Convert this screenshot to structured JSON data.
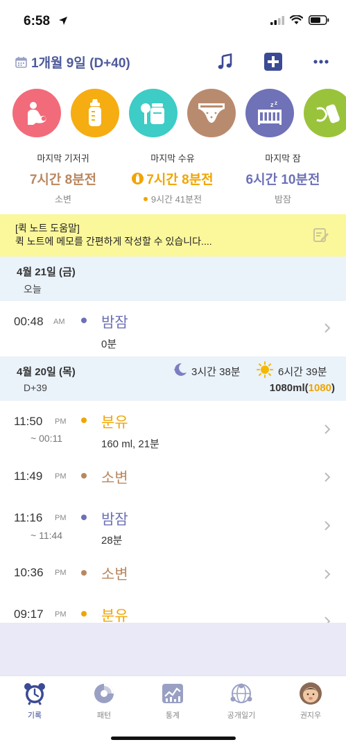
{
  "status": {
    "time": "6:58"
  },
  "header": {
    "date_title": "1개월 9일 (D+40)"
  },
  "categories": [
    {
      "name": "breastfeeding",
      "color": "#f26b7a"
    },
    {
      "name": "bottle",
      "color": "#f5ad12"
    },
    {
      "name": "pumped-milk",
      "color": "#3dccc6"
    },
    {
      "name": "diaper",
      "color": "#b98b6e"
    },
    {
      "name": "sleep",
      "color": "#6f72b7"
    },
    {
      "name": "baby-food",
      "color": "#9ac33c"
    }
  ],
  "summary": {
    "diaper": {
      "label": "마지막 기저귀",
      "value": "7시간 8분전",
      "sub": "소변",
      "color": "#b9875f"
    },
    "feeding": {
      "label": "마지막 수유",
      "value": "7시간 8분전",
      "sub": "9시간 41분전",
      "color": "#f0a500"
    },
    "sleep": {
      "label": "마지막 잠",
      "value": "6시간 10분전",
      "sub": "밤잠",
      "color": "#6c70b6"
    }
  },
  "quick_note": {
    "title": "[퀵 노트 도움말]",
    "body": "퀵 노트에 메모를 간편하게 작성할 수 있습니다...."
  },
  "days": [
    {
      "date": "4월 21일 (금)",
      "sub": "오늘"
    },
    {
      "date": "4월 20일 (목)",
      "sub": "D+39",
      "night_sleep": "3시간 38분",
      "day_sleep": "6시간 39분",
      "total_ml": "1080ml",
      "total_paren_open": "(",
      "total_paren_value": "1080",
      "total_paren_close": ")"
    }
  ],
  "records": [
    {
      "time": "00:48",
      "ampm": "AM",
      "end": "",
      "title": "밤잠",
      "detail": "0분",
      "color": "#6c70b6"
    },
    {
      "time": "11:50",
      "ampm": "PM",
      "end": "~ 00:11",
      "title": "분유",
      "detail": "160 ml, 21분",
      "color": "#f0a500"
    },
    {
      "time": "11:49",
      "ampm": "PM",
      "end": "",
      "title": "소변",
      "detail": "",
      "color": "#b9875f"
    },
    {
      "time": "11:16",
      "ampm": "PM",
      "end": "~ 11:44",
      "title": "밤잠",
      "detail": "28분",
      "color": "#6c70b6"
    },
    {
      "time": "10:36",
      "ampm": "PM",
      "end": "",
      "title": "소변",
      "detail": "",
      "color": "#b9875f"
    },
    {
      "time": "09:17",
      "ampm": "PM",
      "end": "",
      "title": "분유",
      "detail": "",
      "color": "#f0a500"
    }
  ],
  "tabs": [
    {
      "label": "기록",
      "icon": "alarm-clock-icon",
      "active": true
    },
    {
      "label": "패턴",
      "icon": "pie-chart-icon",
      "active": false
    },
    {
      "label": "통계",
      "icon": "stats-chart-icon",
      "active": false
    },
    {
      "label": "공개일기",
      "icon": "globe-people-icon",
      "active": false
    },
    {
      "label": "권지우",
      "icon": "baby-avatar-icon",
      "active": false
    }
  ],
  "colors": {
    "accent": "#4e5a9b",
    "active_tab": "#3b4a95"
  }
}
